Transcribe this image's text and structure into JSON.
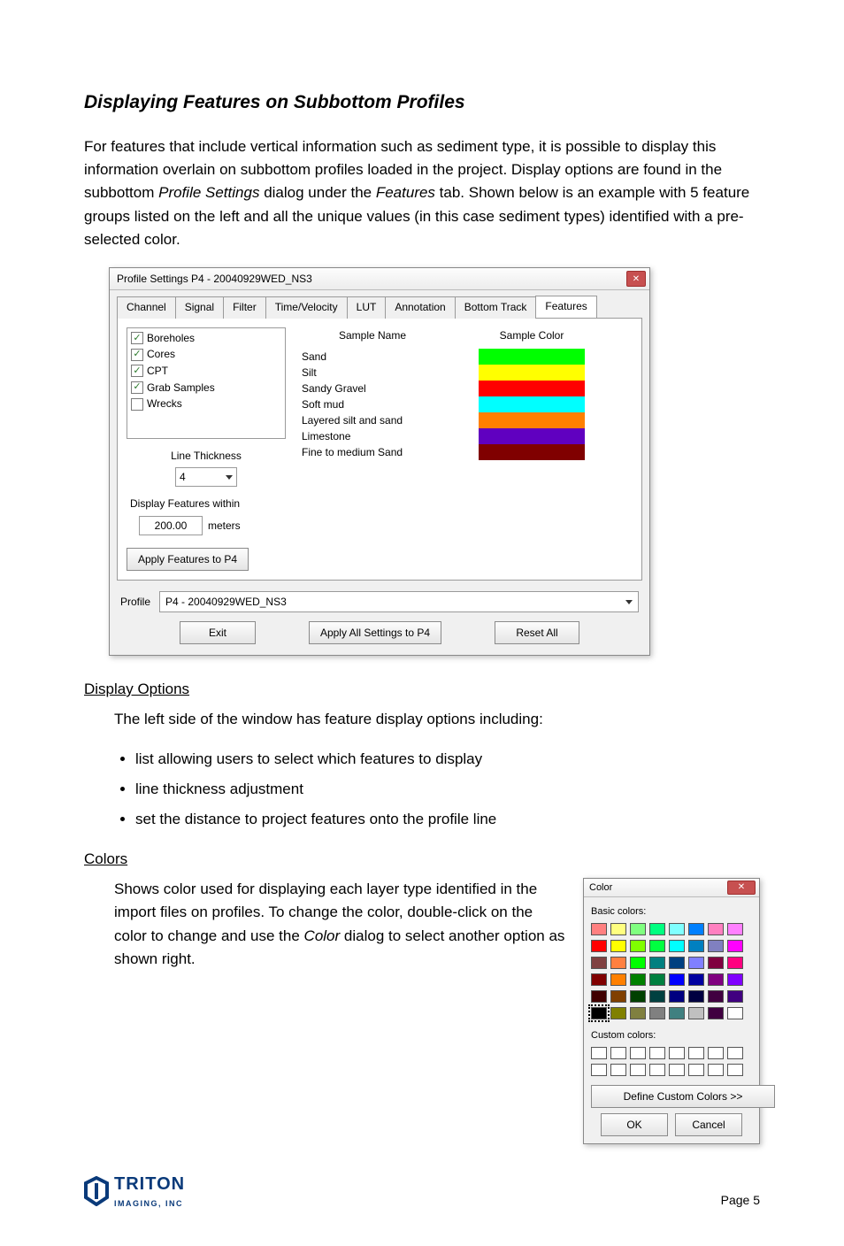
{
  "heading": "Displaying Features on Subbottom Profiles",
  "intro_a": "For features that include vertical information such as sediment type, it is possible to display this information overlain on subbottom profiles loaded in the project.  Display options are found in the subbottom ",
  "intro_b": "Profile Settings",
  "intro_c": " dialog under the ",
  "intro_d": "Features",
  "intro_e": " tab.  Shown below is an example with 5 feature groups listed on the left and all the unique values (in this case sediment types) identified with a pre-selected color.",
  "dlg": {
    "title": "Profile Settings P4 - 20040929WED_NS3",
    "tabs": [
      "Channel",
      "Signal",
      "Filter",
      "Time/Velocity",
      "LUT",
      "Annotation",
      "Bottom Track",
      "Features"
    ],
    "active_tab": "Features",
    "feature_groups": [
      {
        "label": "Boreholes",
        "checked": true
      },
      {
        "label": "Cores",
        "checked": true
      },
      {
        "label": "CPT",
        "checked": true
      },
      {
        "label": "Grab Samples",
        "checked": true
      },
      {
        "label": "Wrecks",
        "checked": false
      }
    ],
    "line_thickness_label": "Line Thickness",
    "line_thickness_value": "4",
    "display_within_label": "Display Features within",
    "display_within_value": "200.00",
    "display_within_units": "meters",
    "apply_button": "Apply Features to P4",
    "sample_name_header": "Sample Name",
    "sample_color_header": "Sample Color",
    "samples": [
      {
        "name": "Sand",
        "color": "#00FF00"
      },
      {
        "name": "Silt",
        "color": "#FFFF00"
      },
      {
        "name": "Sandy Gravel",
        "color": "#FF0000"
      },
      {
        "name": "Soft mud",
        "color": "#00FFFF"
      },
      {
        "name": "Layered silt and sand",
        "color": "#FF8000"
      },
      {
        "name": "Limestone",
        "color": "#6000C0"
      },
      {
        "name": "Fine to medium Sand",
        "color": "#800000"
      }
    ],
    "profile_label": "Profile",
    "profile_value": "P4 - 20040929WED_NS3",
    "exit": "Exit",
    "apply_all": "Apply All Settings to P4",
    "reset_all": "Reset All"
  },
  "dopts": {
    "title": "Display Options",
    "lead": "The left side of the window has feature display options including:",
    "items": [
      "list allowing users to select which features to display",
      "line thickness adjustment",
      "set the distance to project features onto the profile line"
    ]
  },
  "colors": {
    "title": "Colors",
    "txt_a": "Shows color used for displaying each layer type identified in the import files on profiles.  To change the color, double-click on the color to change and use the ",
    "txt_b": "Color",
    "txt_c": " dialog to select another option as shown right."
  },
  "cdlg": {
    "title": "Color",
    "basic_label": "Basic colors:",
    "basic_colors": [
      "#ff8080",
      "#ffff80",
      "#80ff80",
      "#00ff80",
      "#80ffff",
      "#0080ff",
      "#ff80c0",
      "#ff80ff",
      "#ff0000",
      "#ffff00",
      "#80ff00",
      "#00ff40",
      "#00ffff",
      "#0080c0",
      "#8080c0",
      "#ff00ff",
      "#804040",
      "#ff8040",
      "#00ff00",
      "#008080",
      "#004080",
      "#8080ff",
      "#800040",
      "#ff0080",
      "#800000",
      "#ff8000",
      "#008000",
      "#008040",
      "#0000ff",
      "#0000a0",
      "#800080",
      "#8000ff",
      "#400000",
      "#804000",
      "#004000",
      "#004040",
      "#000080",
      "#000040",
      "#400040",
      "#400080",
      "#000000",
      "#808000",
      "#808040",
      "#808080",
      "#408080",
      "#c0c0c0",
      "#400040",
      "#ffffff"
    ],
    "selected_basic_index": 40,
    "custom_label": "Custom colors:",
    "custom_count": 16,
    "define": "Define Custom Colors >>",
    "ok": "OK",
    "cancel": "Cancel"
  },
  "footer": {
    "brand": "TRITON",
    "sub": "IMAGING, INC",
    "page": "Page 5"
  }
}
